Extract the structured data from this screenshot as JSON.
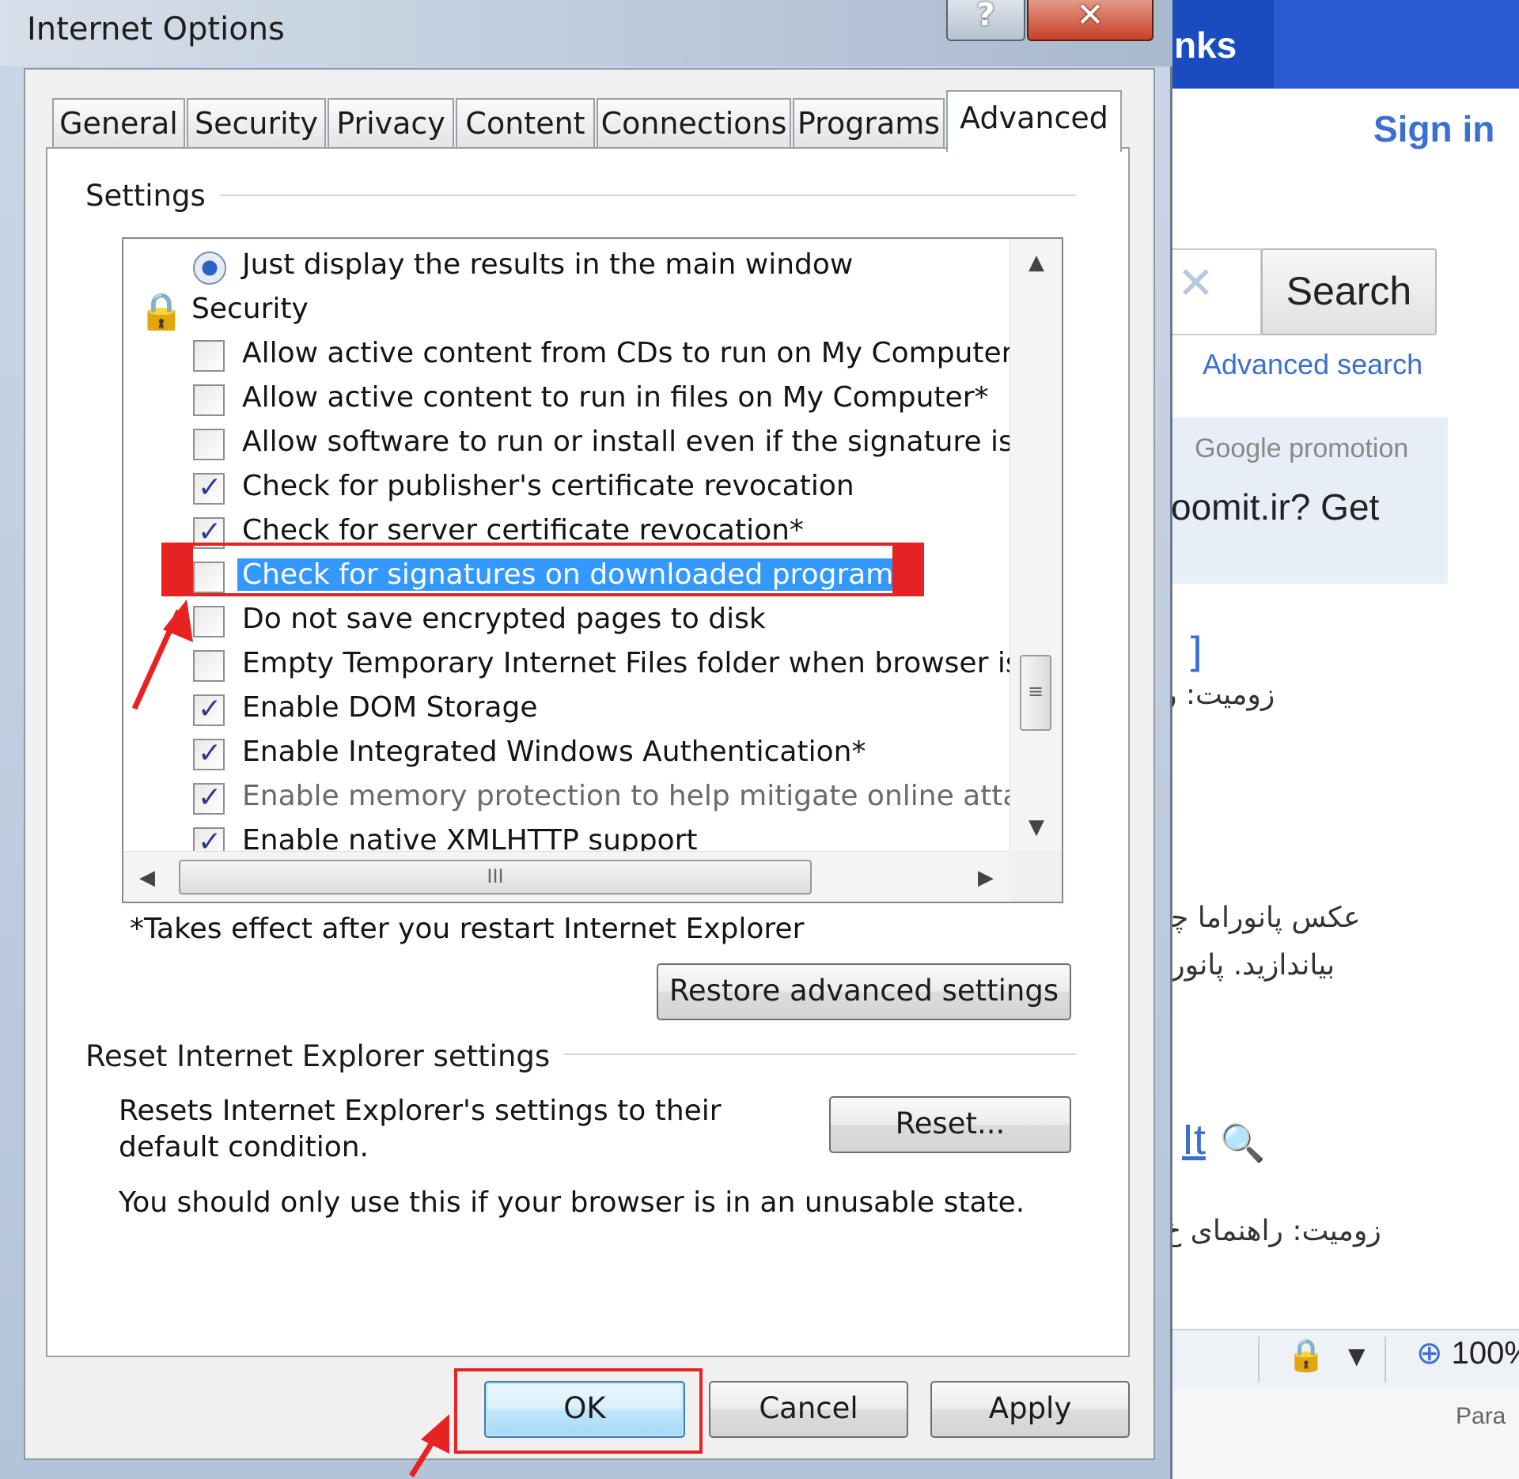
{
  "dialog": {
    "title": "Internet Options",
    "help_glyph": "?",
    "close_glyph": "✕"
  },
  "tabs": [
    {
      "label": "General"
    },
    {
      "label": "Security"
    },
    {
      "label": "Privacy"
    },
    {
      "label": "Content"
    },
    {
      "label": "Connections"
    },
    {
      "label": "Programs"
    },
    {
      "label": "Advanced",
      "active": true
    }
  ],
  "settings": {
    "group_label": "Settings",
    "items": [
      {
        "type": "radio",
        "label": "Just display the results in the main window",
        "checked": true
      },
      {
        "type": "category",
        "label": "Security",
        "icon": "lock-icon"
      },
      {
        "type": "checkbox",
        "label": "Allow active content from CDs to run on My Computer*",
        "checked": false
      },
      {
        "type": "checkbox",
        "label": "Allow active content to run in files on My Computer*",
        "checked": false
      },
      {
        "type": "checkbox",
        "label": "Allow software to run or install even if the signature is inva",
        "checked": false
      },
      {
        "type": "checkbox",
        "label": "Check for publisher's certificate revocation",
        "checked": true
      },
      {
        "type": "checkbox",
        "label": "Check for server certificate revocation*",
        "checked": true
      },
      {
        "type": "checkbox",
        "label": "Check for signatures on downloaded programs",
        "checked": false,
        "selected": true
      },
      {
        "type": "checkbox",
        "label": "Do not save encrypted pages to disk",
        "checked": false
      },
      {
        "type": "checkbox",
        "label": "Empty Temporary Internet Files folder when browser is clo",
        "checked": false
      },
      {
        "type": "checkbox",
        "label": "Enable DOM Storage",
        "checked": true
      },
      {
        "type": "checkbox",
        "label": "Enable Integrated Windows Authentication*",
        "checked": true
      },
      {
        "type": "checkbox",
        "label": "Enable memory protection to help mitigate online attacks*",
        "checked": true,
        "disabled": true
      },
      {
        "type": "checkbox",
        "label": "Enable native XMLHTTP support",
        "checked": true
      }
    ],
    "scroll_grip": "III",
    "note": "*Takes effect after you restart Internet Explorer",
    "restore_button": "Restore advanced settings"
  },
  "reset": {
    "group_label": "Reset Internet Explorer settings",
    "description": "Resets Internet Explorer's settings to their default condition.",
    "warning": "You should only use this if your browser is in an unusable state.",
    "button": "Reset..."
  },
  "footer": {
    "ok": "OK",
    "cancel": "Cancel",
    "apply": "Apply"
  },
  "background_page": {
    "topbar_link": "nks",
    "sign_in": "Sign in",
    "search_button": "Search",
    "advanced_search": "Advanced search",
    "promo_title": "Google promotion",
    "promo_text": "oomit.ir? Get",
    "bracket": "]",
    "farsi_1": "زومیت: را",
    "farsi_2": "عکس پانوراما چی",
    "farsi_3": "بیاندازید. پانوراما",
    "link_it": "It",
    "farsi_4": "زومیت: راهنمای خ",
    "zoom": "100%",
    "para": "Para"
  },
  "colors": {
    "annotation_red": "#e62222",
    "selection_blue": "#3399ff",
    "link_blue": "#3b6fd0"
  }
}
